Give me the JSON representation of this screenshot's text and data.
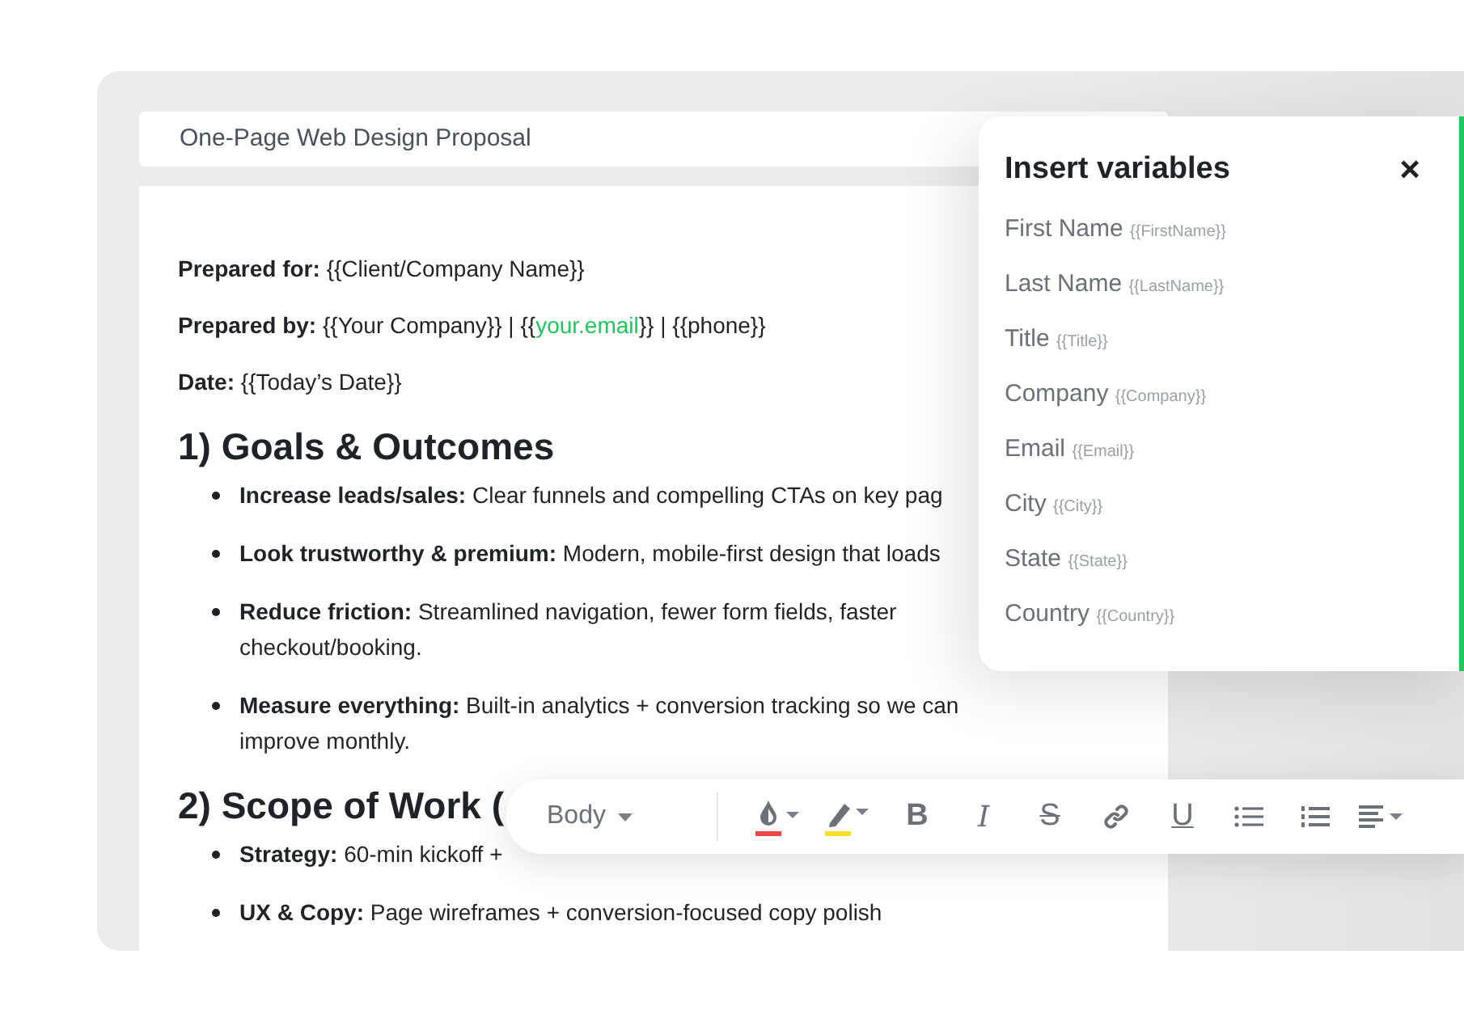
{
  "document": {
    "title": "One-Page Web Design Proposal",
    "meta": [
      {
        "label": "Prepared for:",
        "parts": [
          {
            "text": "{{Client/Company Name}}",
            "highlight": false
          }
        ]
      },
      {
        "label": "Prepared by:",
        "parts": [
          {
            "text": "{{Your Company}} | {{",
            "highlight": false
          },
          {
            "text": "your.email",
            "highlight": true
          },
          {
            "text": "}} | {{phone}}",
            "highlight": false
          }
        ]
      },
      {
        "label": "Date:",
        "parts": [
          {
            "text": "{{Today’s Date}}",
            "highlight": false
          }
        ]
      }
    ],
    "sections": [
      {
        "heading": "1) Goals & Outcomes",
        "bullets": [
          "**Increase leads/sales:** Clear funnels and compelling CTAs on key pag",
          "**Look trustworthy & premium:** Modern, mobile-first design that loads",
          "**Reduce friction:** Streamlined navigation, fewer form fields, faster checkout/booking.",
          "**Measure everything:** Built-in analytics + conversion tracking so we can improve monthly."
        ]
      },
      {
        "heading": "2) Scope of Work (",
        "bullets": [
          "**Strategy:** 60-min kickoff +",
          "**UX & Copy:** Page wireframes + conversion-focused copy polish"
        ]
      }
    ]
  },
  "variables_panel": {
    "title": "Insert variables",
    "close": "×",
    "items": [
      {
        "label": "First Name",
        "token": "{{FirstName}}"
      },
      {
        "label": "Last Name",
        "token": "{{LastName}}"
      },
      {
        "label": "Title",
        "token": "{{Title}}"
      },
      {
        "label": "Company",
        "token": "{{Company}}"
      },
      {
        "label": "Email",
        "token": "{{Email}}"
      },
      {
        "label": "City",
        "token": "{{City}}"
      },
      {
        "label": "State",
        "token": "{{State}}"
      },
      {
        "label": "Country",
        "token": "{{Country}}"
      }
    ]
  },
  "toolbar": [
    {
      "kind": "style",
      "label": "Body"
    },
    {
      "kind": "text-color",
      "color": "#f04848"
    },
    {
      "kind": "highlight",
      "color": "#f5e02a"
    },
    {
      "kind": "bold",
      "glyph": "B"
    },
    {
      "kind": "italic",
      "glyph": "I"
    },
    {
      "kind": "strike",
      "glyph": "S"
    },
    {
      "kind": "link"
    },
    {
      "kind": "underline",
      "glyph": "U"
    },
    {
      "kind": "bullets"
    },
    {
      "kind": "numbered"
    },
    {
      "kind": "align"
    }
  ]
}
